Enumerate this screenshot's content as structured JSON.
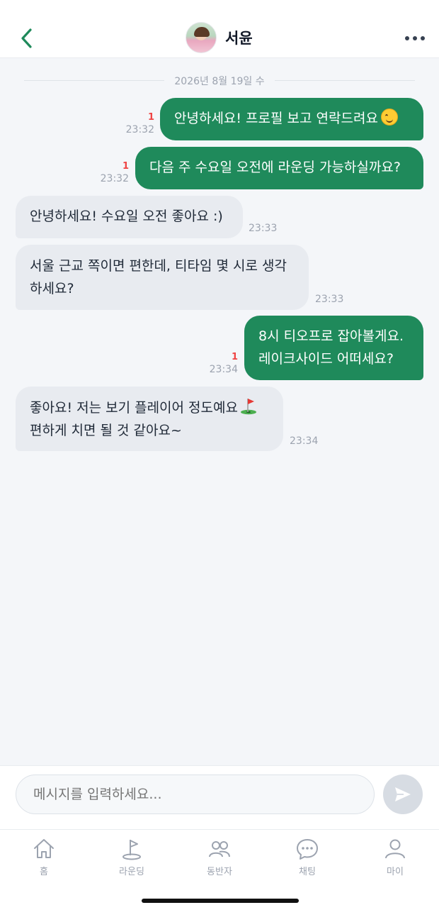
{
  "header": {
    "title": "서윤",
    "back_icon": "chevron-left-icon",
    "more_icon": "more-horizontal-icon"
  },
  "date_separator": "2026년 8월 19일 수",
  "messages": [
    {
      "dir": "out",
      "text": "안녕하세요! 프로필 보고 연락드려요",
      "emoji": "smiling-face-emoji",
      "unread": "1",
      "time": "23:32"
    },
    {
      "dir": "out",
      "text": "다음 주 수요일 오전에 라운딩 가능하실까요?",
      "unread": "1",
      "time": "23:32"
    },
    {
      "dir": "in",
      "text": "안녕하세요! 수요일 오전 좋아요 :)",
      "time": "23:33"
    },
    {
      "dir": "in",
      "lines": [
        "서울 근교 쪽이면 편한데, 티타임 몇 시로 생각",
        "하세요?"
      ],
      "time": "23:33"
    },
    {
      "dir": "out",
      "lines": [
        "8시 티오프로 잡아볼게요.",
        "레이크사이드 어떠세요?"
      ],
      "unread": "1",
      "time": "23:34"
    },
    {
      "dir": "in",
      "lines": [
        "좋아요! 저는 보기 플레이어 정도예요",
        "편하게 치면 될 것 같아요~"
      ],
      "emoji": "golf-flag-emoji",
      "time": "23:34"
    }
  ],
  "composer": {
    "placeholder": "메시지를 입력하세요...",
    "send_icon": "send-icon"
  },
  "tabbar": {
    "items": [
      {
        "label": "홈",
        "icon": "home-icon"
      },
      {
        "label": "라운딩",
        "icon": "golf-flag-icon"
      },
      {
        "label": "동반자",
        "icon": "users-icon"
      },
      {
        "label": "채팅",
        "icon": "chat-bubble-icon"
      },
      {
        "label": "마이",
        "icon": "user-icon"
      }
    ]
  },
  "colors": {
    "accent": "#1f8a5b",
    "incoming_bubble": "#e8ebf0",
    "unread": "#ef4444",
    "background": "#f4f6f9"
  }
}
